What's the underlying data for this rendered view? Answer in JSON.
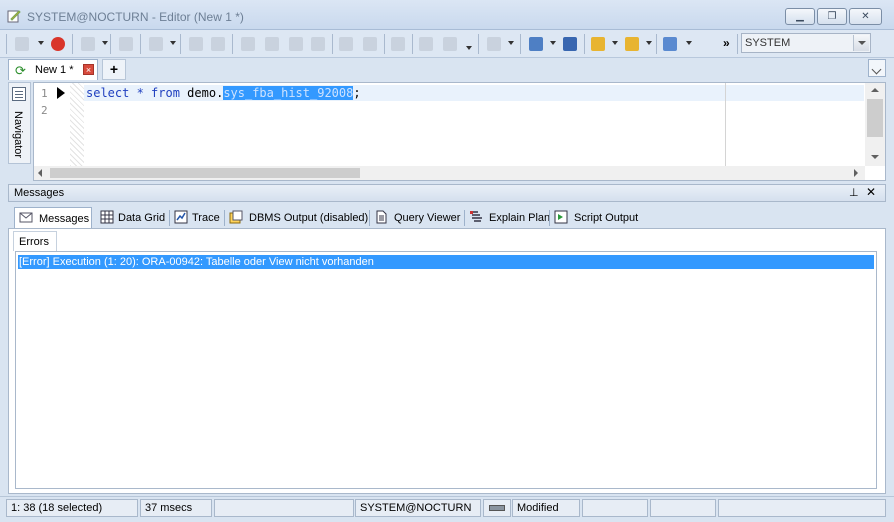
{
  "window": {
    "title": "SYSTEM@NOCTURN - Editor (New 1 *)"
  },
  "toolbar": {
    "connection": "SYSTEM"
  },
  "editor_tab": {
    "label": "New 1 *",
    "add_label": "+"
  },
  "navigator": {
    "label": "Navigator"
  },
  "editor": {
    "line_numbers": [
      "1",
      "2"
    ],
    "code": {
      "kw1": "select",
      "star": " * ",
      "kw2": "from",
      "schema": " demo.",
      "selected": "sys_fba_hist_92008",
      "end": ";"
    }
  },
  "messages": {
    "header": "Messages",
    "pin": "⊥",
    "close": "✕",
    "tabs": [
      {
        "label": "Messages"
      },
      {
        "label": "Data Grid"
      },
      {
        "label": "Trace"
      },
      {
        "label": "DBMS Output (disabled)"
      },
      {
        "label": "Query Viewer"
      },
      {
        "label": "Explain Plan"
      },
      {
        "label": "Script Output"
      }
    ],
    "errors_tab": "Errors",
    "error_row": "[Error] Execution (1: 20): ORA-00942: Tabelle oder View nicht vorhanden"
  },
  "status": {
    "position": "1: 38  (18 selected)",
    "time": "37 msecs",
    "connection": "SYSTEM@NOCTURN",
    "state": "Modified"
  }
}
